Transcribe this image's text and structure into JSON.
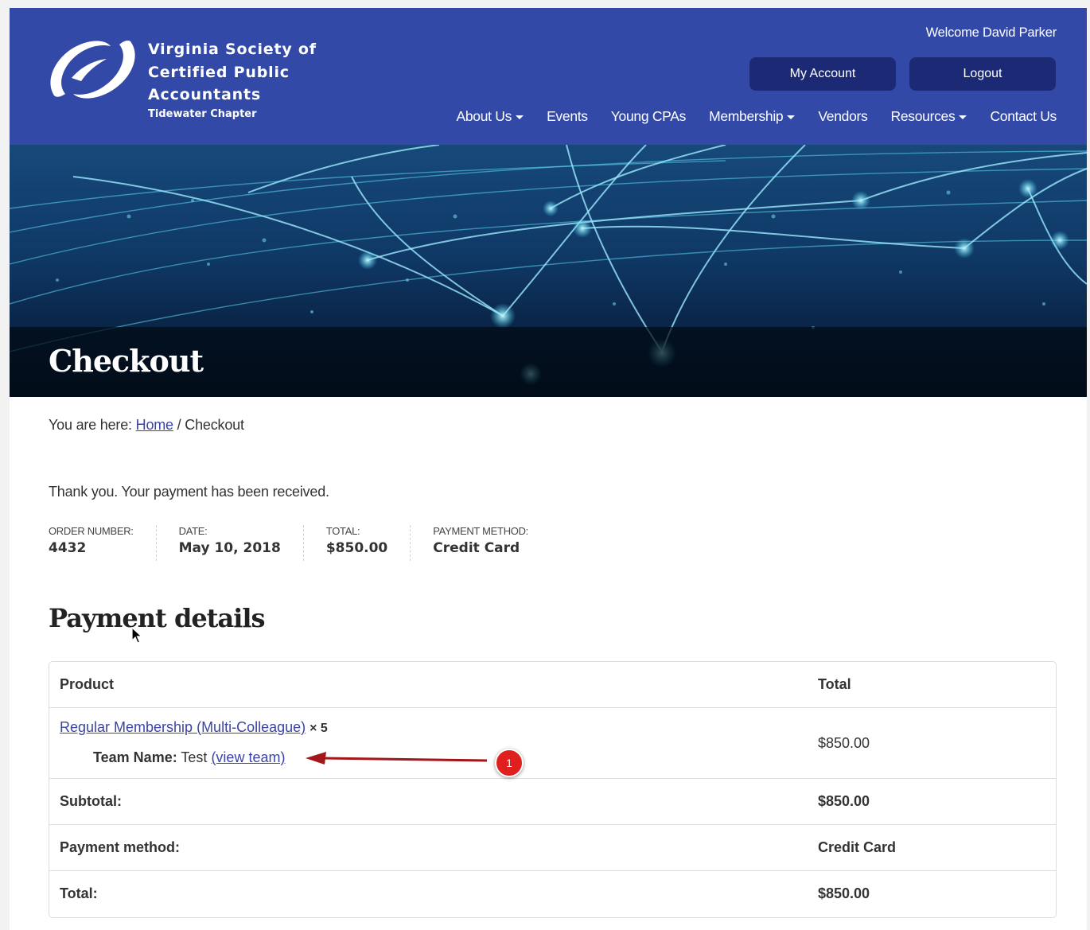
{
  "header": {
    "org_name": "Virginia Society of Certified Public Accountants",
    "chapter": "Tidewater Chapter",
    "welcome": "Welcome David Parker",
    "my_account": "My Account",
    "logout": "Logout",
    "brand_color": "#3349a8",
    "button_color": "#1c2a75"
  },
  "nav": [
    {
      "label": "About Us",
      "dropdown": true
    },
    {
      "label": "Events",
      "dropdown": false
    },
    {
      "label": "Young CPAs",
      "dropdown": false
    },
    {
      "label": "Membership",
      "dropdown": true
    },
    {
      "label": "Vendors",
      "dropdown": false
    },
    {
      "label": "Resources",
      "dropdown": true
    },
    {
      "label": "Contact Us",
      "dropdown": false
    }
  ],
  "banner": {
    "title": "Checkout"
  },
  "breadcrumb": {
    "prefix": "You are here:",
    "home": "Home",
    "separator": "/",
    "current": "Checkout"
  },
  "order": {
    "thanks": "Thank you. Your payment has been received.",
    "overview": [
      {
        "label": "Order number:",
        "value": "4432"
      },
      {
        "label": "Date:",
        "value": "May 10, 2018"
      },
      {
        "label": "Total:",
        "value": "$850.00"
      },
      {
        "label": "Payment method:",
        "value": "Credit Card"
      }
    ]
  },
  "payment_details": {
    "title": "Payment details",
    "headers": {
      "product": "Product",
      "total": "Total"
    },
    "item": {
      "name": "Regular Membership (Multi-Colleague)",
      "qty": "× 5",
      "meta_label": "Team Name:",
      "meta_value": "Test",
      "meta_link": "(view team)",
      "total": "$850.00"
    },
    "subtotal": {
      "label": "Subtotal:",
      "value": "$850.00"
    },
    "payment_method": {
      "label": "Payment method:",
      "value": "Credit Card"
    },
    "total": {
      "label": "Total:",
      "value": "$850.00"
    }
  },
  "annotation": {
    "badge": "1",
    "color": "#e0201e"
  }
}
